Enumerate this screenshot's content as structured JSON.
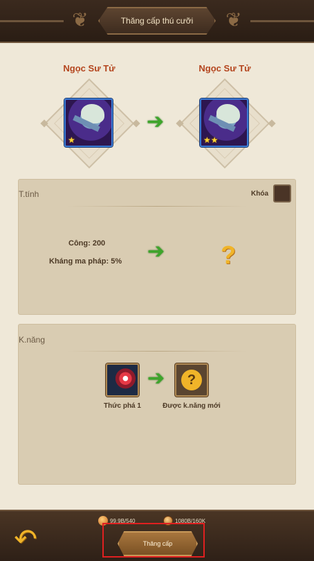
{
  "header": {
    "title": "Thăng cấp thú cưỡi"
  },
  "pet": {
    "current": {
      "name": "Ngọc Sư Tử",
      "stars": "★"
    },
    "next": {
      "name": "Ngọc Sư Tử",
      "stars": "★★"
    }
  },
  "stats_panel": {
    "title": "T.tính",
    "lock_label": "Khóa",
    "stats": [
      "Công: 200",
      "Kháng ma pháp: 5%"
    ],
    "unknown": "?"
  },
  "skills_panel": {
    "title": "K.năng",
    "current_skill": "Thức phá 1",
    "next_skill": "Được k.năng mới",
    "unknown": "?"
  },
  "footer": {
    "resource_1": "99.9B/540",
    "resource_2": "1080B/160K",
    "upgrade_label": "Thăng cấp"
  },
  "colors": {
    "accent_green": "#3ea52b",
    "name_color": "#b4451e",
    "highlight": "#e02020"
  },
  "icons": [
    "back-arrow-icon",
    "green-arrow-icon",
    "question-icon",
    "lock-icon"
  ]
}
